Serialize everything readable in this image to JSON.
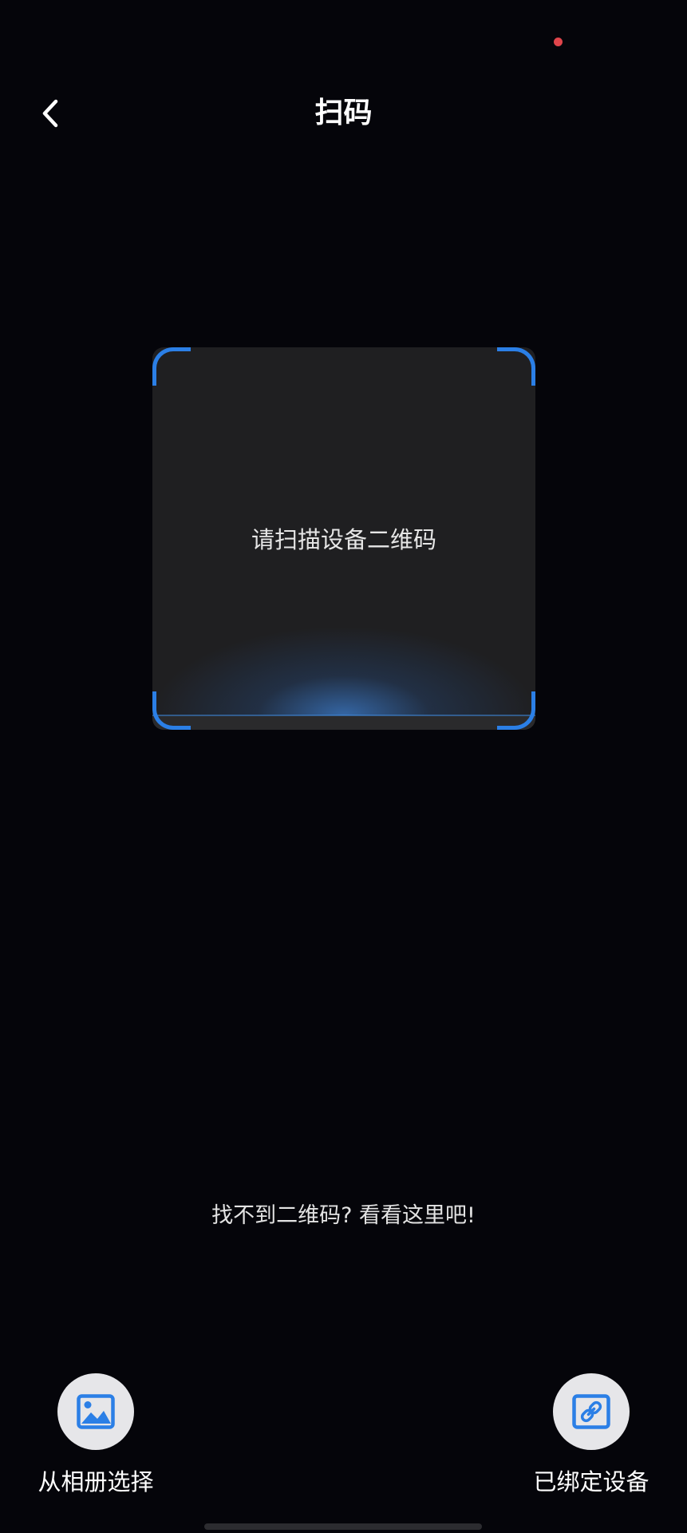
{
  "status_bar": {
    "indicator_color": "#e0454b"
  },
  "header": {
    "back_icon": "chevron-left-icon",
    "title": "扫码"
  },
  "scanner": {
    "hint": "请扫描设备二维码",
    "frame_color": "#2b7fe6"
  },
  "help_link": {
    "label": "找不到二维码? 看看这里吧!"
  },
  "actions": {
    "album": {
      "label": "从相册选择",
      "icon": "image-icon"
    },
    "bound_devices": {
      "label": "已绑定设备",
      "icon": "link-icon"
    }
  }
}
